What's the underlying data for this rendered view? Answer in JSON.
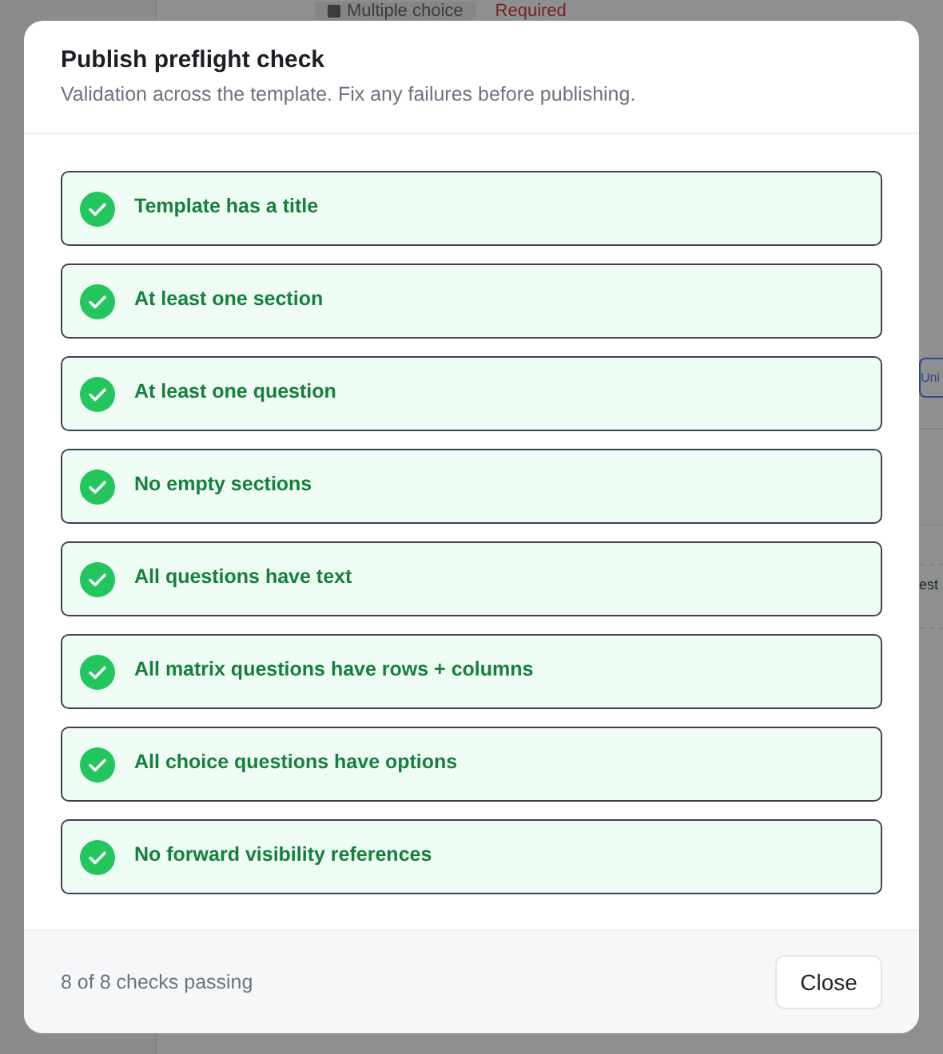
{
  "background": {
    "type_chip": "Multiple choice",
    "required_label": "Required",
    "side_chip": "Uni",
    "side_text": "est"
  },
  "dialog": {
    "title": "Publish preflight check",
    "subtitle": "Validation across the template. Fix any failures before publishing.",
    "checks": [
      {
        "label": "Template has a title",
        "passed": true
      },
      {
        "label": "At least one section",
        "passed": true
      },
      {
        "label": "At least one question",
        "passed": true
      },
      {
        "label": "No empty sections",
        "passed": true
      },
      {
        "label": "All questions have text",
        "passed": true
      },
      {
        "label": "All matrix questions have rows + columns",
        "passed": true
      },
      {
        "label": "All choice questions have options",
        "passed": true
      },
      {
        "label": "No forward visibility references",
        "passed": true
      }
    ],
    "summary": "8 of 8 checks passing",
    "close_button": "Close"
  }
}
